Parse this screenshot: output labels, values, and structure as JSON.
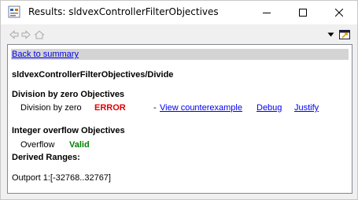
{
  "window": {
    "title": "Results: sldvexControllerFilterObjectives"
  },
  "icons": {
    "app": "report-icon",
    "back": "back-arrow-icon",
    "forward": "forward-arrow-icon",
    "home": "home-icon",
    "dropdown": "chevron-down-icon",
    "dock": "dock-icon"
  },
  "colors": {
    "error": "#e00000",
    "valid": "#008000",
    "link": "#0000ee"
  },
  "report": {
    "back_link": "Back to summary",
    "path_heading": "sldvexControllerFilterObjectives/Divide",
    "division": {
      "heading": "Division by zero Objectives",
      "label": "Division by zero",
      "status": "ERROR",
      "separator": "-",
      "view_link": "View counterexample",
      "debug_link": "Debug",
      "justify_link": "Justify"
    },
    "overflow": {
      "heading": "Integer overflow Objectives",
      "label": "Overflow",
      "status": "Valid"
    },
    "ranges": {
      "heading": "Derived Ranges:",
      "outport": "Outport 1:[-32768..32767]"
    }
  }
}
